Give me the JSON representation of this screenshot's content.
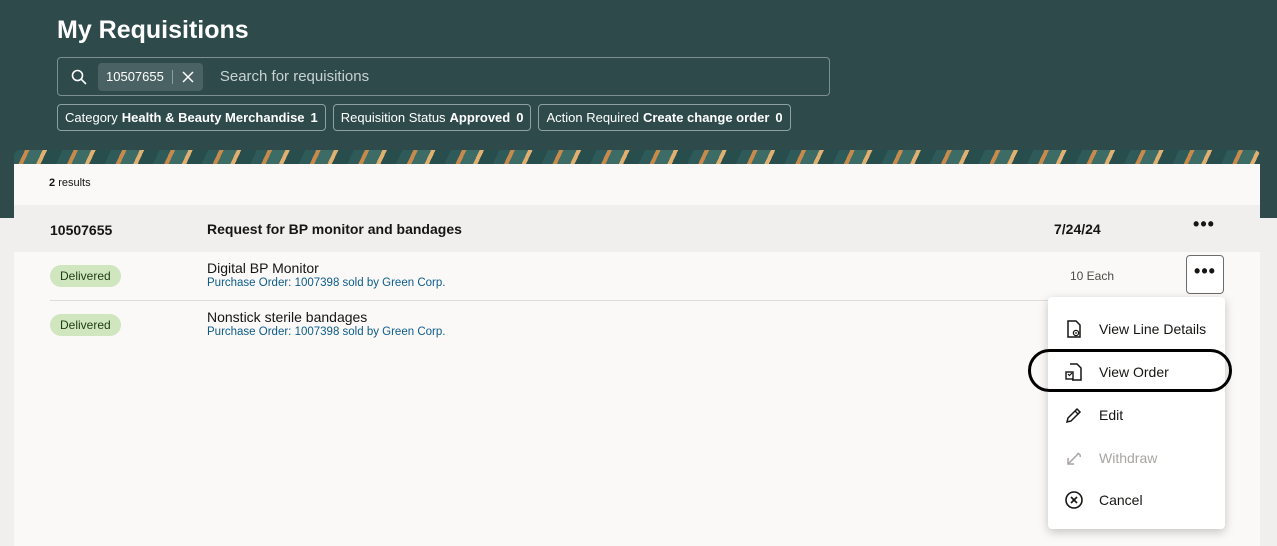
{
  "page": {
    "title": "My Requisitions"
  },
  "search": {
    "chip_value": "10507655",
    "placeholder": "Search for requisitions"
  },
  "filters": [
    {
      "label": "Category",
      "value": "Health & Beauty Merchandise",
      "count": "1"
    },
    {
      "label": "Requisition Status",
      "value": "Approved",
      "count": "0"
    },
    {
      "label": "Action Required",
      "value": "Create change order",
      "count": "0"
    }
  ],
  "results": {
    "count": "2",
    "label": "results"
  },
  "requisition": {
    "id": "10507655",
    "description": "Request for BP monitor and bandages",
    "date": "7/24/24",
    "more": "•••"
  },
  "lines": [
    {
      "status": "Delivered",
      "name": "Digital BP Monitor",
      "po": "Purchase Order: 1007398 sold by Green Corp.",
      "qty": "10 Each"
    },
    {
      "status": "Delivered",
      "name": "Nonstick sterile bandages",
      "po": "Purchase Order: 1007398 sold by Green Corp.",
      "qty": ""
    }
  ],
  "line_more": "•••",
  "menu": {
    "items": [
      {
        "label": "View Line Details",
        "icon": "document-view-icon",
        "enabled": true
      },
      {
        "label": "View Order",
        "icon": "document-order-icon",
        "enabled": true,
        "highlighted": true
      },
      {
        "label": "Edit",
        "icon": "pencil-icon",
        "enabled": true
      },
      {
        "label": "Withdraw",
        "icon": "undo-arrow-icon",
        "enabled": false
      },
      {
        "label": "Cancel",
        "icon": "circle-x-icon",
        "enabled": true
      }
    ]
  },
  "colors": {
    "header_bg": "#2f4a4b",
    "badge_bg": "#cfe6bf",
    "link": "#0b5c8a"
  }
}
